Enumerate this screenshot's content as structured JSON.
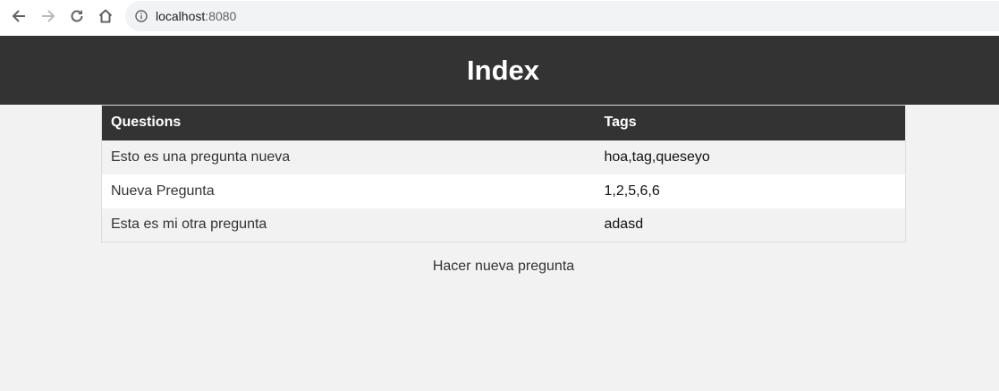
{
  "browser": {
    "url_host": "localhost",
    "url_port": ":8080",
    "icons": [
      "back-icon",
      "forward-icon",
      "reload-icon",
      "home-icon",
      "info-icon"
    ]
  },
  "header": {
    "title": "Index"
  },
  "table": {
    "headers": {
      "questions": "Questions",
      "tags": "Tags"
    },
    "rows": [
      {
        "question": "Esto es una pregunta nueva",
        "tags": "hoa,tag,queseyo"
      },
      {
        "question": "Nueva Pregunta",
        "tags": "1,2,5,6,6"
      },
      {
        "question": "Esta es mi otra pregunta",
        "tags": "adasd"
      }
    ]
  },
  "link": {
    "new_question": "Hacer nueva pregunta"
  },
  "colors": {
    "header_bg": "#333333",
    "page_bg": "#f2f2f2",
    "row_alt": "#ffffff"
  }
}
